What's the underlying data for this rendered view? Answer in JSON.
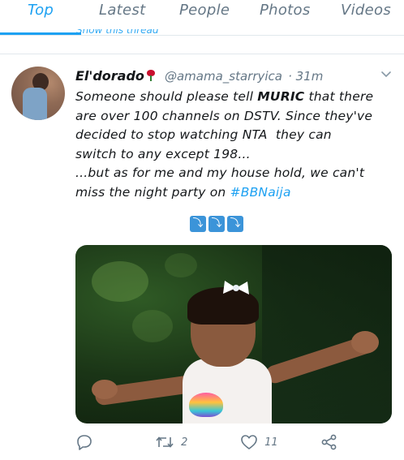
{
  "tabs": [
    {
      "label": "Top",
      "active": true
    },
    {
      "label": "Latest",
      "active": false
    },
    {
      "label": "People",
      "active": false
    },
    {
      "label": "Photos",
      "active": false
    },
    {
      "label": "Videos",
      "active": false
    }
  ],
  "thread_link": "Show this thread",
  "tweet": {
    "name": "El'dorado",
    "name_emoji": "rose-icon",
    "handle": "@amama_starryica",
    "time": "· 31m",
    "lines": [
      "Someone should please tell MURIC that there",
      "are over 100 channels on DSTV. Since they've",
      "decided to stop watching NTA  they can",
      "switch to any except 198...",
      "...but as for me and my house hold, we can't"
    ],
    "line1_pre": "Someone should please tell ",
    "line1_bold": "MURIC",
    "line1_post": " that there",
    "last_line_pre": "miss the night party on ",
    "hashtag": "#BBNaija",
    "emoji_row": [
      "⤵",
      "⤵",
      "⤵"
    ],
    "photo_alt": "child in white top with outstretched arms"
  },
  "actions": {
    "reply_count": "",
    "retweet_count": "2",
    "like_count": "11",
    "share_icon": "share-icon"
  },
  "colors": {
    "accent": "#1da1f2",
    "muted": "#657786",
    "text": "#14171a"
  }
}
